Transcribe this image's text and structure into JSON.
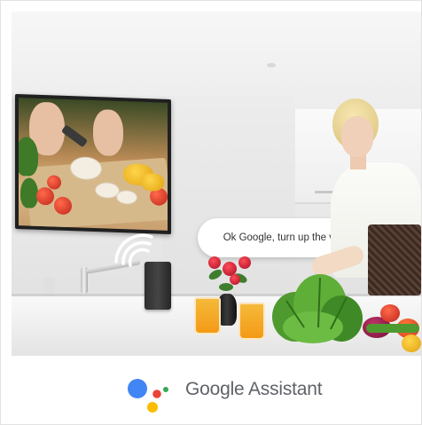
{
  "speech_bubble": {
    "text": "Ok Google, turn up the volume"
  },
  "branding": {
    "text": "Google Assistant",
    "logo_icon": "google-assistant-dots-icon",
    "colors": {
      "blue": "#4285F4",
      "red": "#EA4335",
      "yellow": "#FBBC05",
      "green": "#34A853",
      "text": "#5f6368"
    }
  },
  "scene": {
    "icons": [
      "wifi-signal-icon",
      "smart-speaker-icon"
    ]
  }
}
